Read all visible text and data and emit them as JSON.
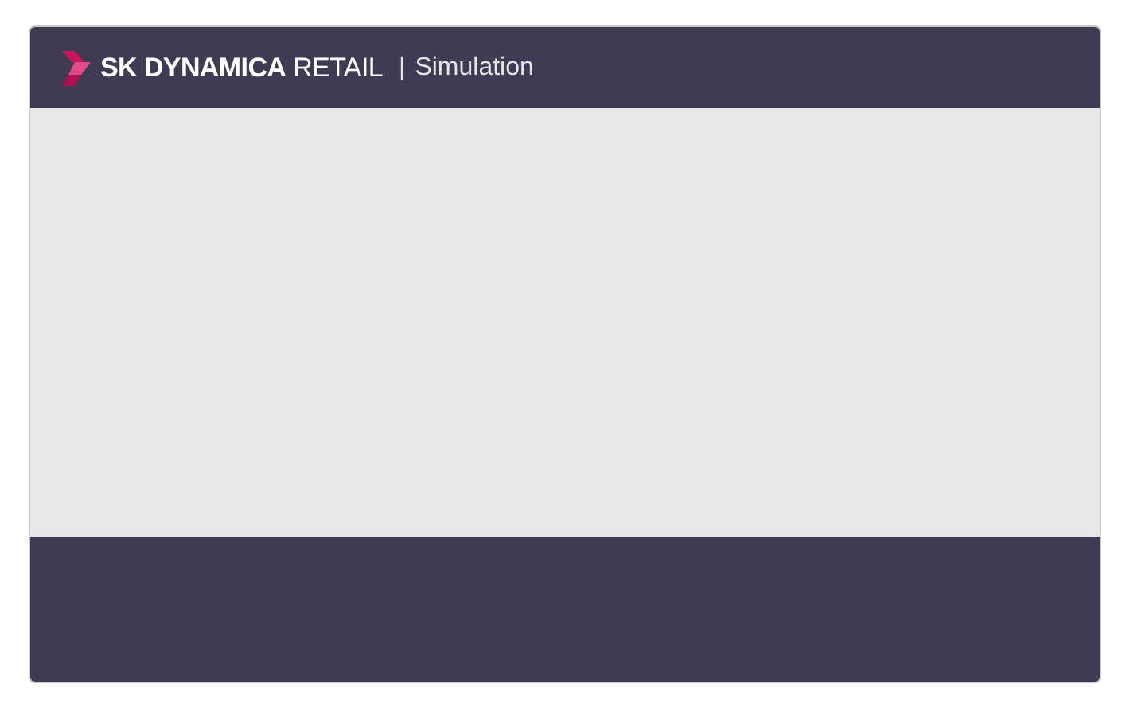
{
  "header": {
    "brand": "**SK DYNAMICA** RETAIL",
    "separator": "|",
    "title": "Simulation"
  }
}
